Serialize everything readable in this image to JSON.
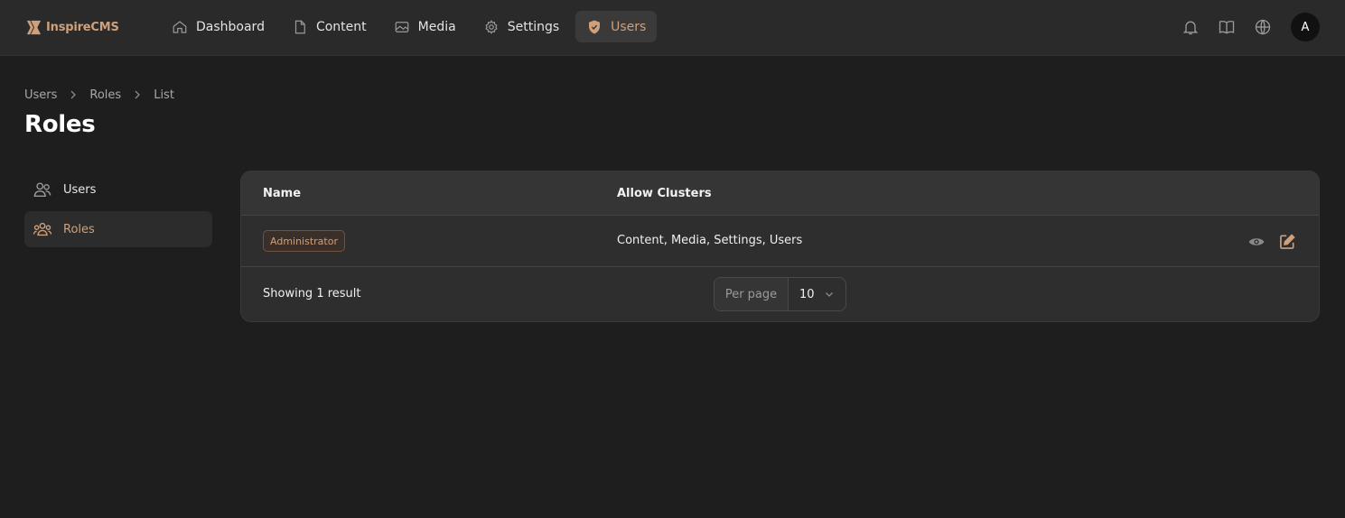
{
  "app": {
    "name": "InspireCMS"
  },
  "nav": {
    "items": [
      {
        "label": "Dashboard",
        "icon": "home-icon"
      },
      {
        "label": "Content",
        "icon": "document-icon"
      },
      {
        "label": "Media",
        "icon": "image-icon"
      },
      {
        "label": "Settings",
        "icon": "gear-icon"
      },
      {
        "label": "Users",
        "icon": "shield-icon",
        "active": true
      }
    ]
  },
  "topbar": {
    "avatar_initial": "A",
    "icons": [
      "bell-icon",
      "book-icon",
      "globe-icon"
    ]
  },
  "breadcrumb": [
    "Users",
    "Roles",
    "List"
  ],
  "page": {
    "title": "Roles"
  },
  "sidebar": {
    "items": [
      {
        "label": "Users",
        "icon": "users-icon"
      },
      {
        "label": "Roles",
        "icon": "user-group-icon",
        "active": true
      }
    ]
  },
  "table": {
    "columns": [
      "Name",
      "Allow Clusters"
    ],
    "rows": [
      {
        "name": "Administrator",
        "clusters": "Content, Media, Settings, Users"
      }
    ],
    "footer": {
      "showing": "Showing 1 result",
      "per_page_label": "Per page",
      "per_page_value": "10"
    }
  },
  "colors": {
    "accent": "#cfa07a",
    "background": "#1e1e1e",
    "topbar": "#2a2a2a",
    "card": "#2e2e2e"
  }
}
